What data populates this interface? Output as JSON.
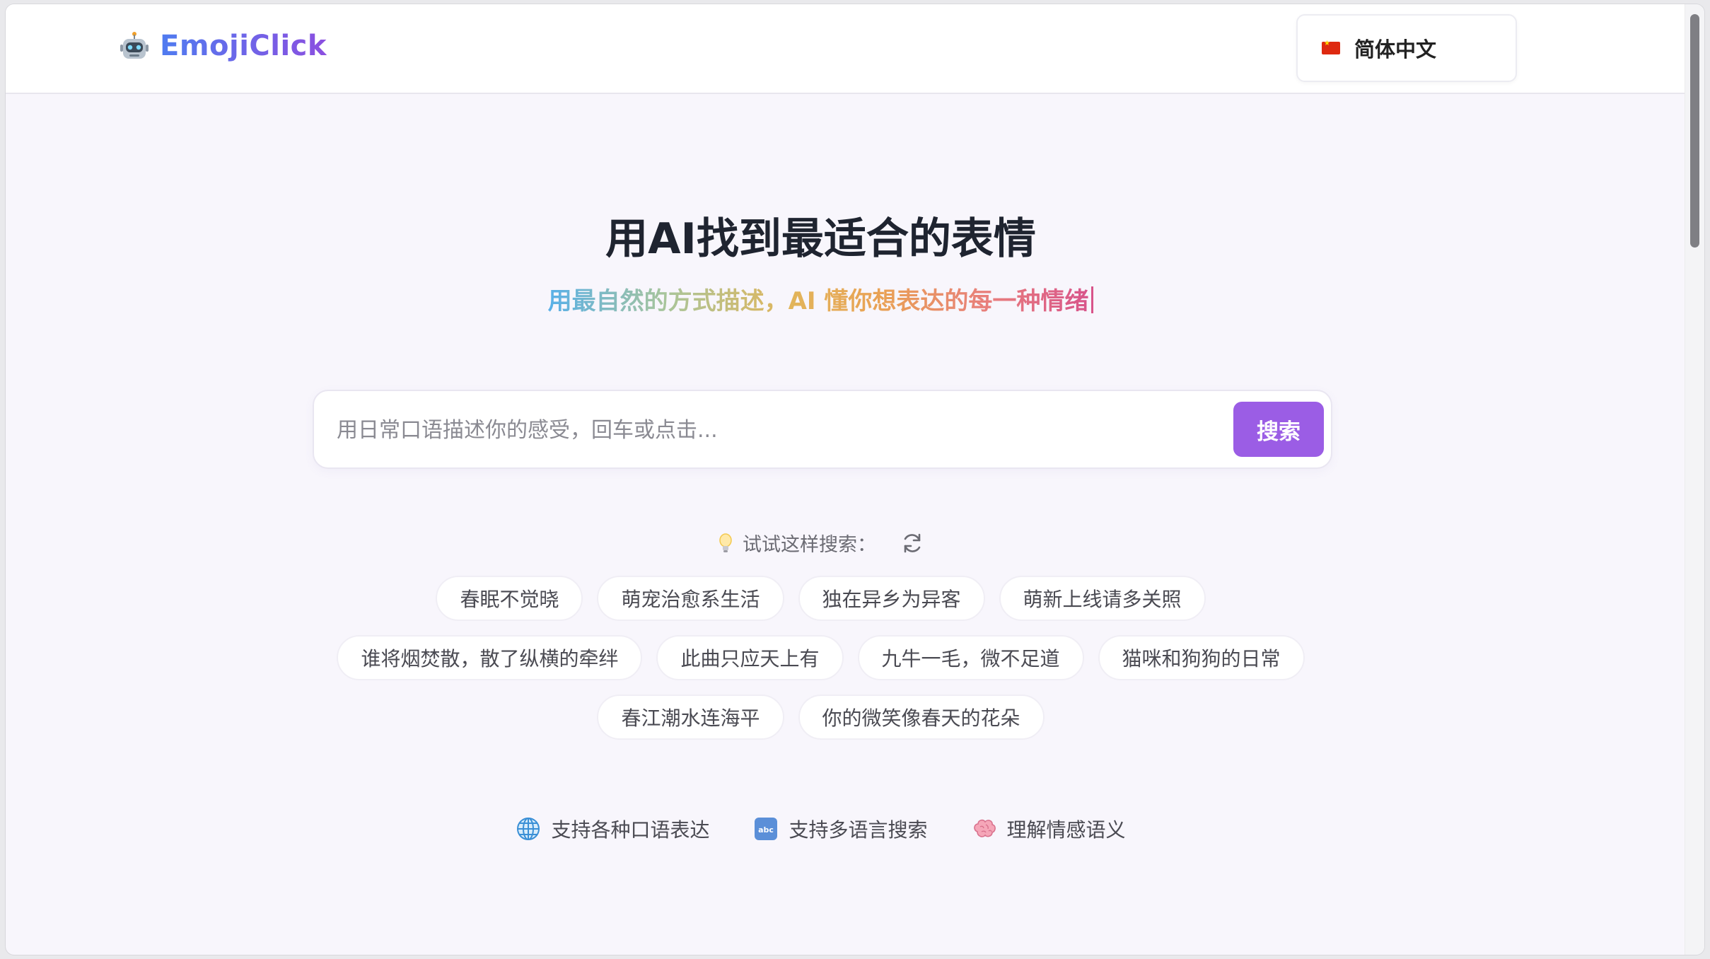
{
  "header": {
    "brand": "EmojiClick",
    "language": {
      "flag": "cn-flag-icon",
      "label": "简体中文"
    }
  },
  "hero": {
    "title": "用AI找到最适合的表情",
    "subtitle": "用最自然的方式描述，AI 懂你想表达的每一种情绪"
  },
  "search": {
    "placeholder": "用日常口语描述你的感受，回车或点击...",
    "value": "",
    "button_label": "搜索"
  },
  "suggestions": {
    "label": "试试这样搜索：",
    "rows": [
      [
        "春眠不觉晓",
        "萌宠治愈系生活",
        "独在异乡为异客",
        "萌新上线请多关照"
      ],
      [
        "谁将烟焚散，散了纵横的牵绊",
        "此曲只应天上有",
        "九牛一毛，微不足道",
        "猫咪和狗狗的日常"
      ],
      [
        "春江潮水连海平",
        "你的微笑像春天的花朵"
      ]
    ]
  },
  "features": [
    {
      "icon": "globe-icon",
      "label": "支持各种口语表达"
    },
    {
      "icon": "abc-icon",
      "label": "支持多语言搜索"
    },
    {
      "icon": "brain-icon",
      "label": "理解情感语义"
    }
  ],
  "colors": {
    "accent": "#9b5de5",
    "brand_gradient": [
      "#4f7cf0",
      "#8b4fe0"
    ],
    "background": "#f8f6fc"
  }
}
